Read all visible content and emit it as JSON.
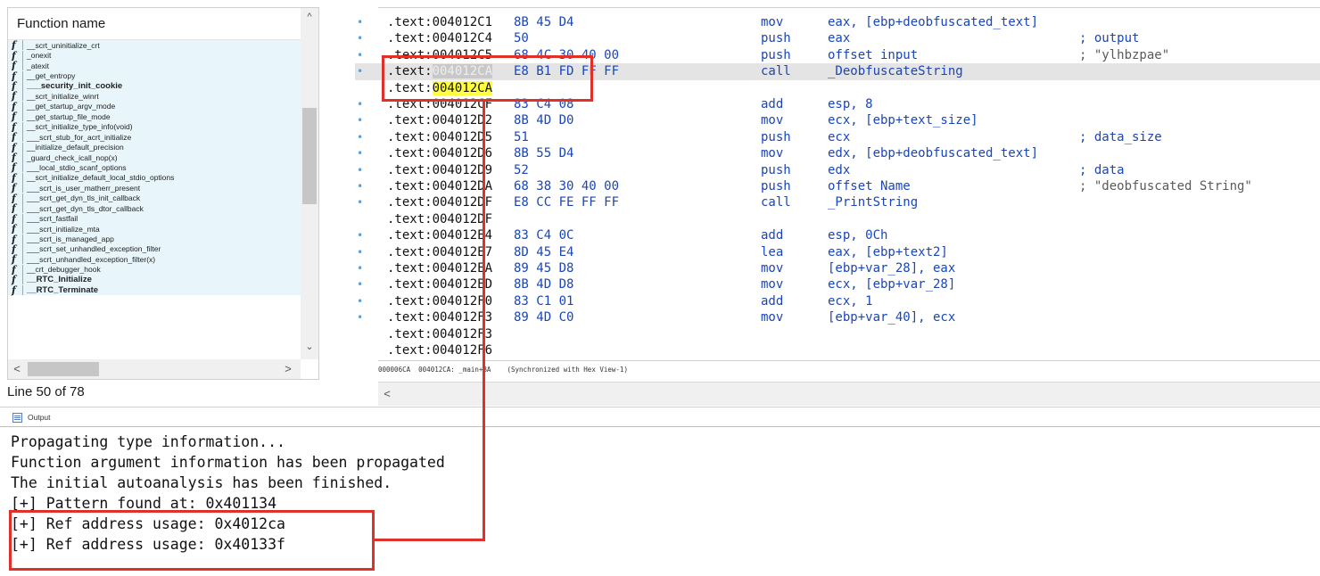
{
  "function_panel": {
    "header": "Function name",
    "functions": [
      {
        "name": "__scrt_uninitialize_crt",
        "bold": false
      },
      {
        "name": "_onexit",
        "bold": false
      },
      {
        "name": "_atexit",
        "bold": false
      },
      {
        "name": "__get_entropy",
        "bold": false
      },
      {
        "name": "___security_init_cookie",
        "bold": true
      },
      {
        "name": "__scrt_initialize_winrt",
        "bold": false
      },
      {
        "name": "__get_startup_argv_mode",
        "bold": false
      },
      {
        "name": "__get_startup_file_mode",
        "bold": false
      },
      {
        "name": "__scrt_initialize_type_info(void)",
        "bold": false
      },
      {
        "name": "___scrt_stub_for_acrt_initialize",
        "bold": false
      },
      {
        "name": "__initialize_default_precision",
        "bold": false
      },
      {
        "name": "_guard_check_icall_nop(x)",
        "bold": false
      },
      {
        "name": "___local_stdio_scanf_options",
        "bold": false
      },
      {
        "name": "__scrt_initialize_default_local_stdio_options",
        "bold": false
      },
      {
        "name": "___scrt_is_user_matherr_present",
        "bold": false
      },
      {
        "name": "___scrt_get_dyn_tls_init_callback",
        "bold": false
      },
      {
        "name": "___scrt_get_dyn_tls_dtor_callback",
        "bold": false
      },
      {
        "name": "___scrt_fastfail",
        "bold": false
      },
      {
        "name": "___scrt_initialize_mta",
        "bold": false
      },
      {
        "name": "___scrt_is_managed_app",
        "bold": false
      },
      {
        "name": "___scrt_set_unhandled_exception_filter",
        "bold": false
      },
      {
        "name": "___scrt_unhandled_exception_filter(x)",
        "bold": false
      },
      {
        "name": "__crt_debugger_hook",
        "bold": false
      },
      {
        "name": "__RTC_Initialize",
        "bold": true
      },
      {
        "name": "__RTC_Terminate",
        "bold": true
      }
    ],
    "status": "Line 50 of 78"
  },
  "disassembly": {
    "lines": [
      {
        "dot": true,
        "addr_pre": ".text:",
        "addr_main": "004012C1",
        "bytes": "8B 45 D4",
        "mnem": "mov",
        "oper": "eax, [ebp+deobfuscated_text]",
        "comment": "",
        "selected": false,
        "hl": ""
      },
      {
        "dot": true,
        "addr_pre": ".text:",
        "addr_main": "004012C4",
        "bytes": "50",
        "mnem": "push",
        "oper": "eax",
        "comment": "; output",
        "selected": false,
        "hl": ""
      },
      {
        "dot": true,
        "addr_pre": ".text:",
        "addr_main": "004012C5",
        "bytes": "68 4C 30 40 00",
        "mnem": "push",
        "oper": "offset input",
        "comment": "; \"ylhbzpae\"",
        "selected": false,
        "hl": ""
      },
      {
        "dot": true,
        "addr_pre": ".text:",
        "addr_main": "004012CA",
        "bytes": "E8 B1 FD FF FF",
        "mnem": "call",
        "oper": "_DeobfuscateString",
        "comment": "",
        "selected": true,
        "hl": "gray"
      },
      {
        "dot": false,
        "addr_pre": ".text:",
        "addr_main": "004012CA",
        "bytes": "",
        "mnem": "",
        "oper": "",
        "comment": "",
        "selected": false,
        "hl": "yellow"
      },
      {
        "dot": true,
        "addr_pre": ".text:",
        "addr_main": "004012CF",
        "bytes": "83 C4 08",
        "mnem": "add",
        "oper": "esp, 8",
        "comment": "",
        "selected": false,
        "hl": ""
      },
      {
        "dot": true,
        "addr_pre": ".text:",
        "addr_main": "004012D2",
        "bytes": "8B 4D D0",
        "mnem": "mov",
        "oper": "ecx, [ebp+text_size]",
        "comment": "",
        "selected": false,
        "hl": ""
      },
      {
        "dot": true,
        "addr_pre": ".text:",
        "addr_main": "004012D5",
        "bytes": "51",
        "mnem": "push",
        "oper": "ecx",
        "comment": "; data_size",
        "selected": false,
        "hl": ""
      },
      {
        "dot": true,
        "addr_pre": ".text:",
        "addr_main": "004012D6",
        "bytes": "8B 55 D4",
        "mnem": "mov",
        "oper": "edx, [ebp+deobfuscated_text]",
        "comment": "",
        "selected": false,
        "hl": ""
      },
      {
        "dot": true,
        "addr_pre": ".text:",
        "addr_main": "004012D9",
        "bytes": "52",
        "mnem": "push",
        "oper": "edx",
        "comment": "; data",
        "selected": false,
        "hl": ""
      },
      {
        "dot": true,
        "addr_pre": ".text:",
        "addr_main": "004012DA",
        "bytes": "68 38 30 40 00",
        "mnem": "push",
        "oper": "offset Name",
        "comment": "; \"deobfuscated String\"",
        "selected": false,
        "hl": ""
      },
      {
        "dot": true,
        "addr_pre": ".text:",
        "addr_main": "004012DF",
        "bytes": "E8 CC FE FF FF",
        "mnem": "call",
        "oper": "_PrintString",
        "comment": "",
        "selected": false,
        "hl": ""
      },
      {
        "dot": false,
        "addr_pre": ".text:",
        "addr_main": "004012DF",
        "bytes": "",
        "mnem": "",
        "oper": "",
        "comment": "",
        "selected": false,
        "hl": ""
      },
      {
        "dot": true,
        "addr_pre": ".text:",
        "addr_main": "004012E4",
        "bytes": "83 C4 0C",
        "mnem": "add",
        "oper": "esp, 0Ch",
        "comment": "",
        "selected": false,
        "hl": ""
      },
      {
        "dot": true,
        "addr_pre": ".text:",
        "addr_main": "004012E7",
        "bytes": "8D 45 E4",
        "mnem": "lea",
        "oper": "eax, [ebp+text2]",
        "comment": "",
        "selected": false,
        "hl": ""
      },
      {
        "dot": true,
        "addr_pre": ".text:",
        "addr_main": "004012EA",
        "bytes": "89 45 D8",
        "mnem": "mov",
        "oper": "[ebp+var_28], eax",
        "comment": "",
        "selected": false,
        "hl": ""
      },
      {
        "dot": true,
        "addr_pre": ".text:",
        "addr_main": "004012ED",
        "bytes": "8B 4D D8",
        "mnem": "mov",
        "oper": "ecx, [ebp+var_28]",
        "comment": "",
        "selected": false,
        "hl": ""
      },
      {
        "dot": true,
        "addr_pre": ".text:",
        "addr_main": "004012F0",
        "bytes": "83 C1 01",
        "mnem": "add",
        "oper": "ecx, 1",
        "comment": "",
        "selected": false,
        "hl": ""
      },
      {
        "dot": true,
        "addr_pre": ".text:",
        "addr_main": "004012F3",
        "bytes": "89 4D C0",
        "mnem": "mov",
        "oper": "[ebp+var_40], ecx",
        "comment": "",
        "selected": false,
        "hl": ""
      },
      {
        "dot": false,
        "addr_pre": ".text:",
        "addr_main": "004012F3",
        "bytes": "",
        "mnem": "",
        "oper": "",
        "comment": "",
        "selected": false,
        "hl": ""
      },
      {
        "dot": false,
        "addr_pre": ".text:",
        "addr_main": "004012F6",
        "bytes": "",
        "mnem": "",
        "oper": "",
        "comment": "",
        "selected": false,
        "hl": ""
      }
    ],
    "status": "000006CA  004012CA: _main+BA    (Synchronized with Hex View-1)"
  },
  "output": {
    "tab_label": "Output",
    "lines": [
      "Propagating type information...",
      "Function argument information has been propagated",
      "The initial autoanalysis has been finished.",
      "[+] Pattern found at: 0x401134",
      "[+] Ref address usage: 0x4012ca",
      "[+] Ref address usage: 0x40133f"
    ]
  },
  "colors": {
    "annotation": "#e0302a",
    "address_highlight": "#ffff40",
    "code_blue": "#1b46b8",
    "function_row_bg": "#e8f6fb"
  }
}
